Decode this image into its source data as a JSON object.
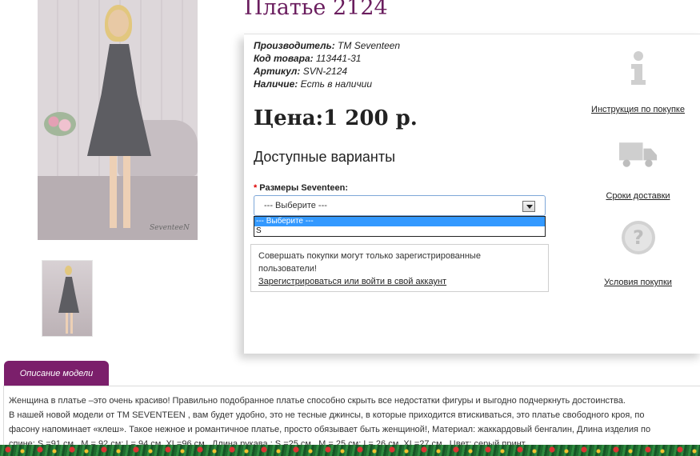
{
  "product": {
    "title": "Платье 2124",
    "meta": [
      {
        "label": "Производитель:",
        "value": "TM Seventeen"
      },
      {
        "label": "Код товара:",
        "value": "113441-31"
      },
      {
        "label": "Артикул:",
        "value": "SVN-2124"
      },
      {
        "label": "Наличие:",
        "value": "Есть в наличии"
      }
    ],
    "price": "Цена:1 200 р.",
    "photo_signature": "SeventeeN"
  },
  "variants": {
    "title": "Доступные варианты",
    "option_label": "Размеры Seventeen:",
    "required_mark": "*",
    "selected": "--- Выберите ---",
    "options": [
      "--- Выберите ---",
      "S"
    ]
  },
  "notice": {
    "text": "Совершать покупки могут только зарегистрированные пользователи!",
    "link": "Зарегистрироваться или войти в свой аккаунт"
  },
  "side_links": [
    {
      "icon": "info-icon",
      "label": "Инструкция по покупке"
    },
    {
      "icon": "truck-icon",
      "label": "Сроки доставки"
    },
    {
      "icon": "question-icon",
      "label": "Условия покупки"
    }
  ],
  "description": {
    "tab": "Описание модели",
    "line1": "Женщина в платье –это очень красиво! Правильно подобранное платье способно скрыть все недостатки фигуры и выгодно подчеркнуть достоинства.",
    "line2": "В нашей новой модели от TM SEVENTEEN , вам будет удобно, это не тесные джинсы, в которые приходится втискиваться, это платье свободного кроя, по",
    "line3": "фасону напоминает «клеш». Такое нежное и романтичное платье, просто обязывает быть женщиной!, Материал: жаккардовый бенгалин, Длина изделия по",
    "line4": "спине: S =91 см., M = 92 см; L= 94 см ,XL=96 см., Длина рукава : S =25 см., M = 25 см; L= 26 см ,XL=27 см., Цвет: серый принт"
  },
  "colors": {
    "title": "#6a1d5e",
    "tab": "#7b1f6b",
    "select_highlight": "#3399ff"
  }
}
